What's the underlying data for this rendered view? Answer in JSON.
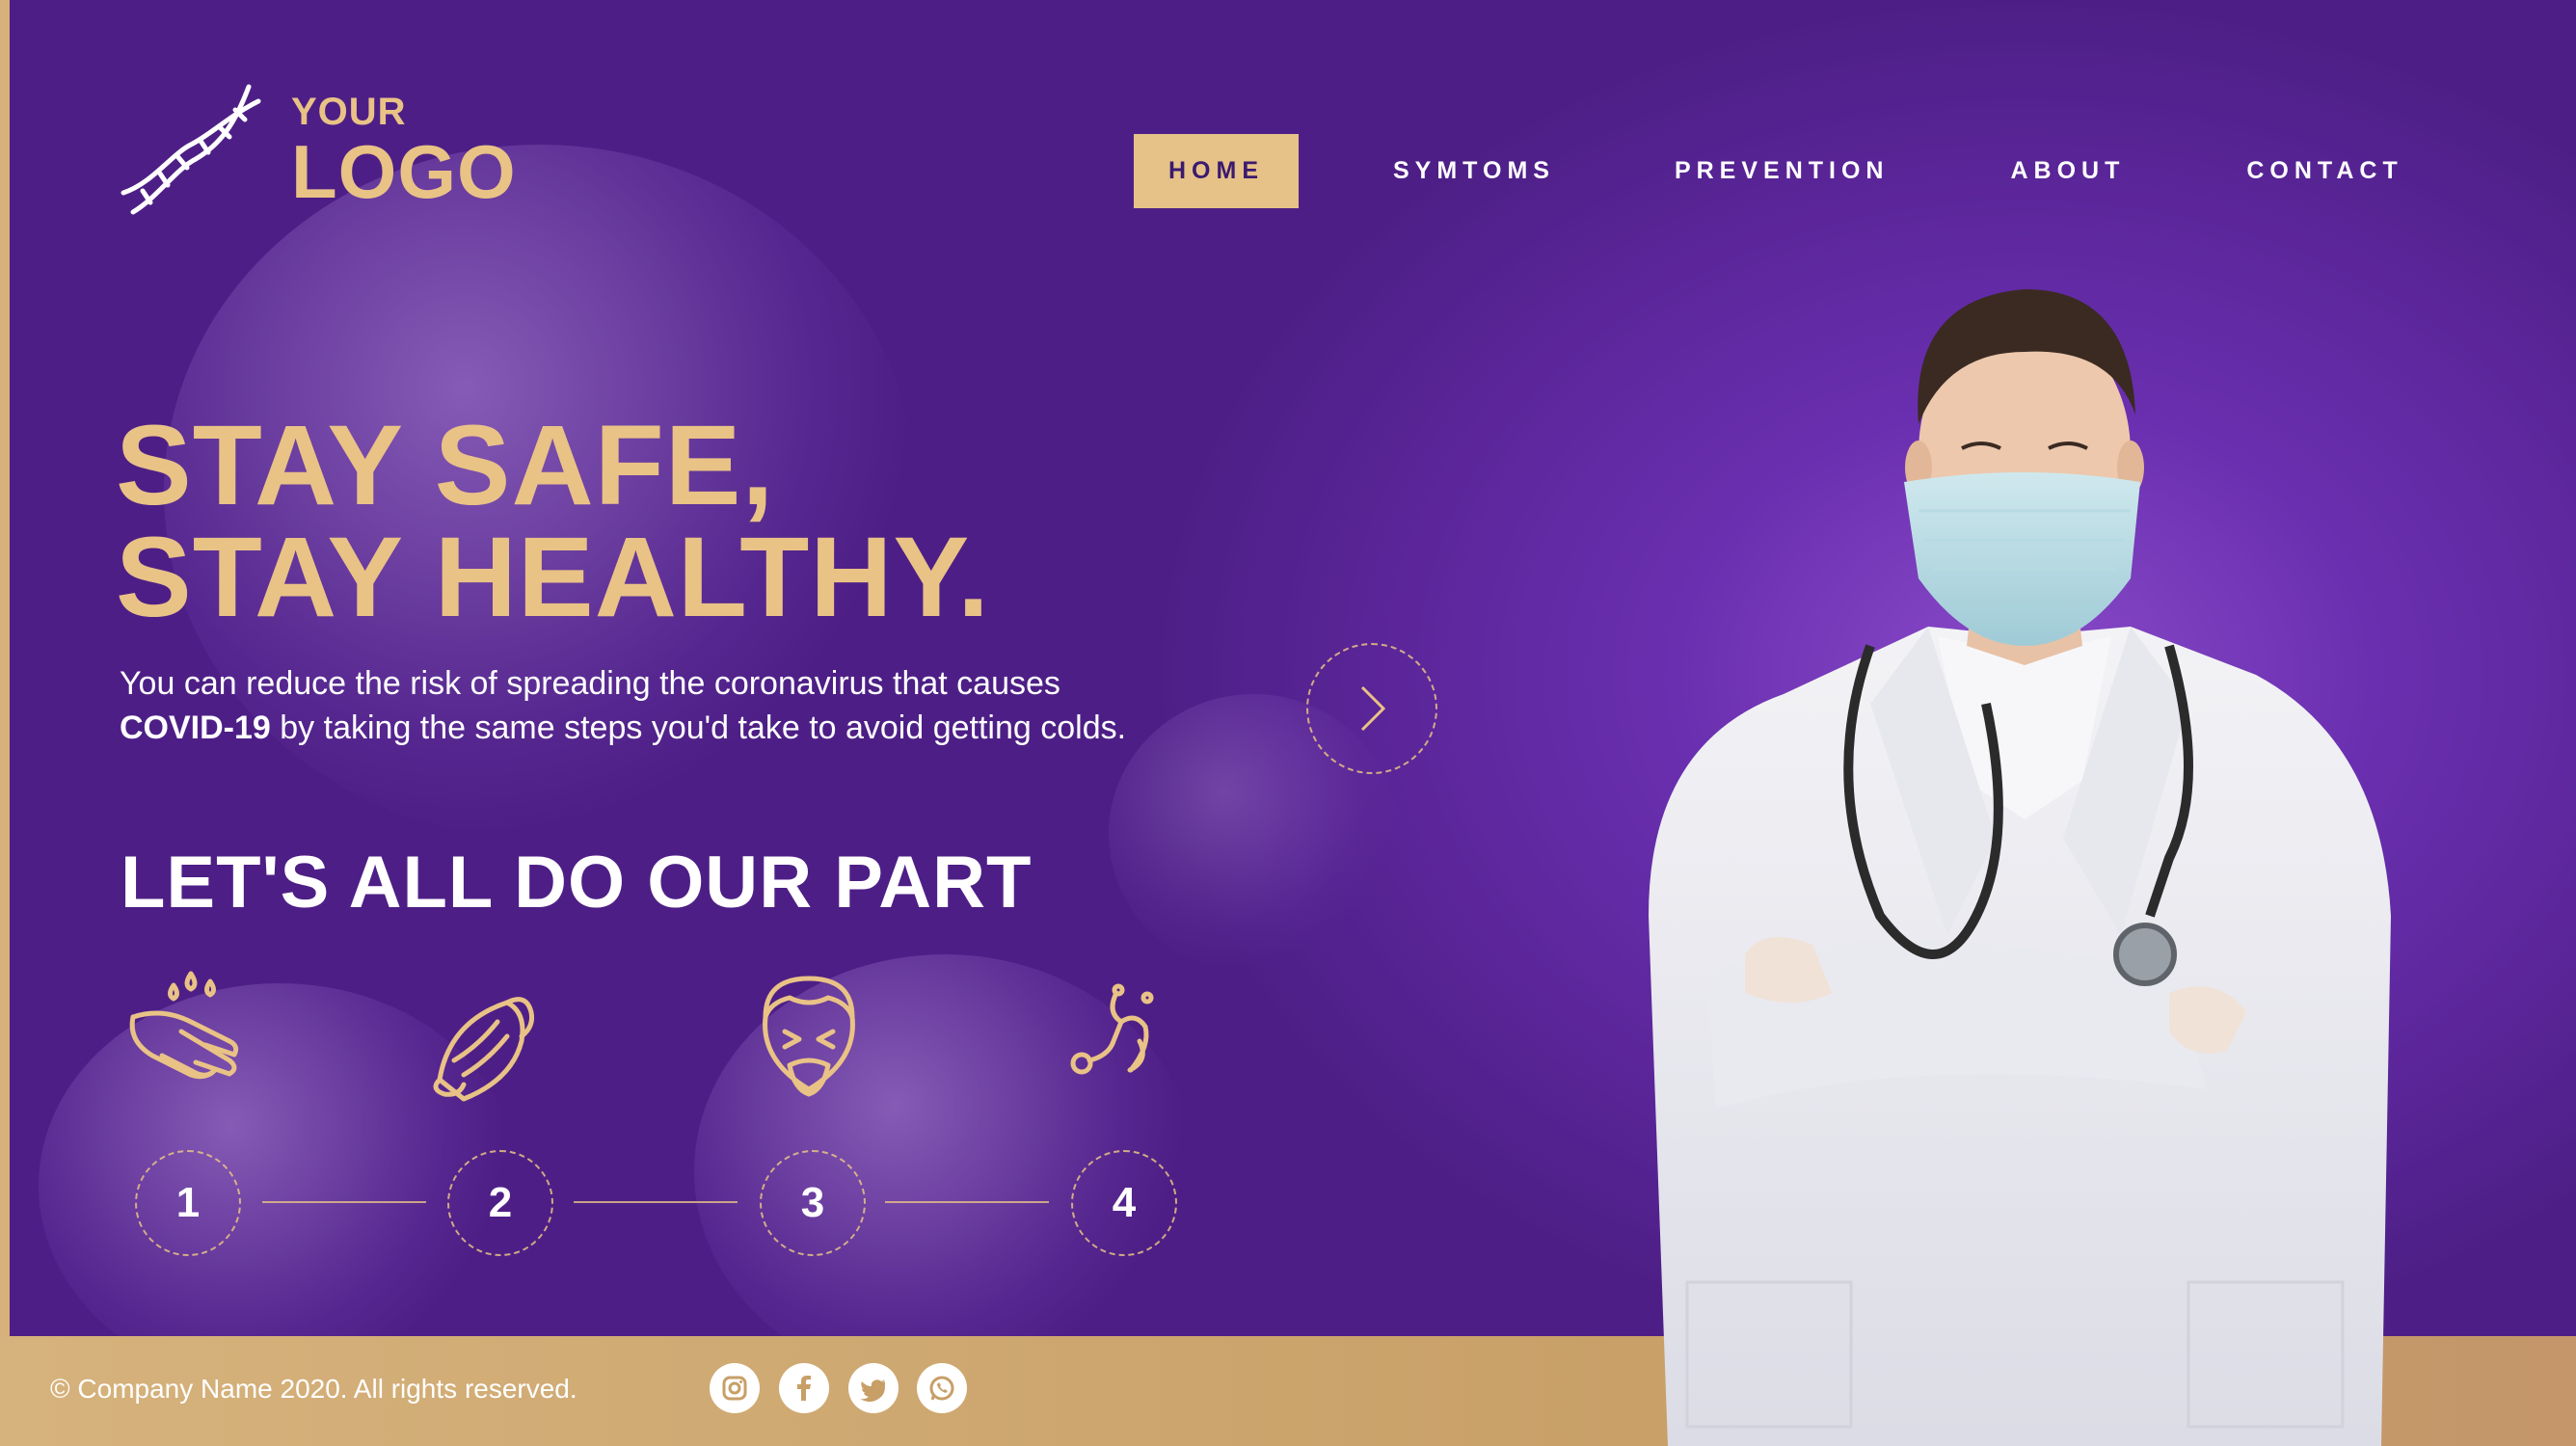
{
  "brand": {
    "logo_line1": "YOUR",
    "logo_line2": "LOGO"
  },
  "nav": {
    "items": [
      "HOME",
      "SYMTOMS",
      "PREVENTION",
      "ABOUT",
      "CONTACT"
    ],
    "active": "HOME"
  },
  "hero": {
    "headline_line1": "STAY SAFE,",
    "headline_line2": "STAY HEALTHY.",
    "desc_line1": "You can reduce the risk of spreading the coronavirus that causes",
    "desc_bold": "COVID-19",
    "desc_line2_rest": " by taking the same steps you'd take to avoid getting colds.",
    "subhead": "LET'S ALL DO OUR PART"
  },
  "steps": [
    "1",
    "2",
    "3",
    "4"
  ],
  "step_icons": [
    "hand-wash-icon",
    "face-mask-icon",
    "sneeze-icon",
    "stethoscope-icon"
  ],
  "footer": {
    "copyright": "© Company Name 2020. All rights reserved.",
    "social": [
      "instagram-icon",
      "facebook-icon",
      "twitter-icon",
      "whatsapp-icon"
    ]
  },
  "colors": {
    "purple": "#5a2598",
    "gold": "#e9c286",
    "footer": "#d6b27c"
  }
}
